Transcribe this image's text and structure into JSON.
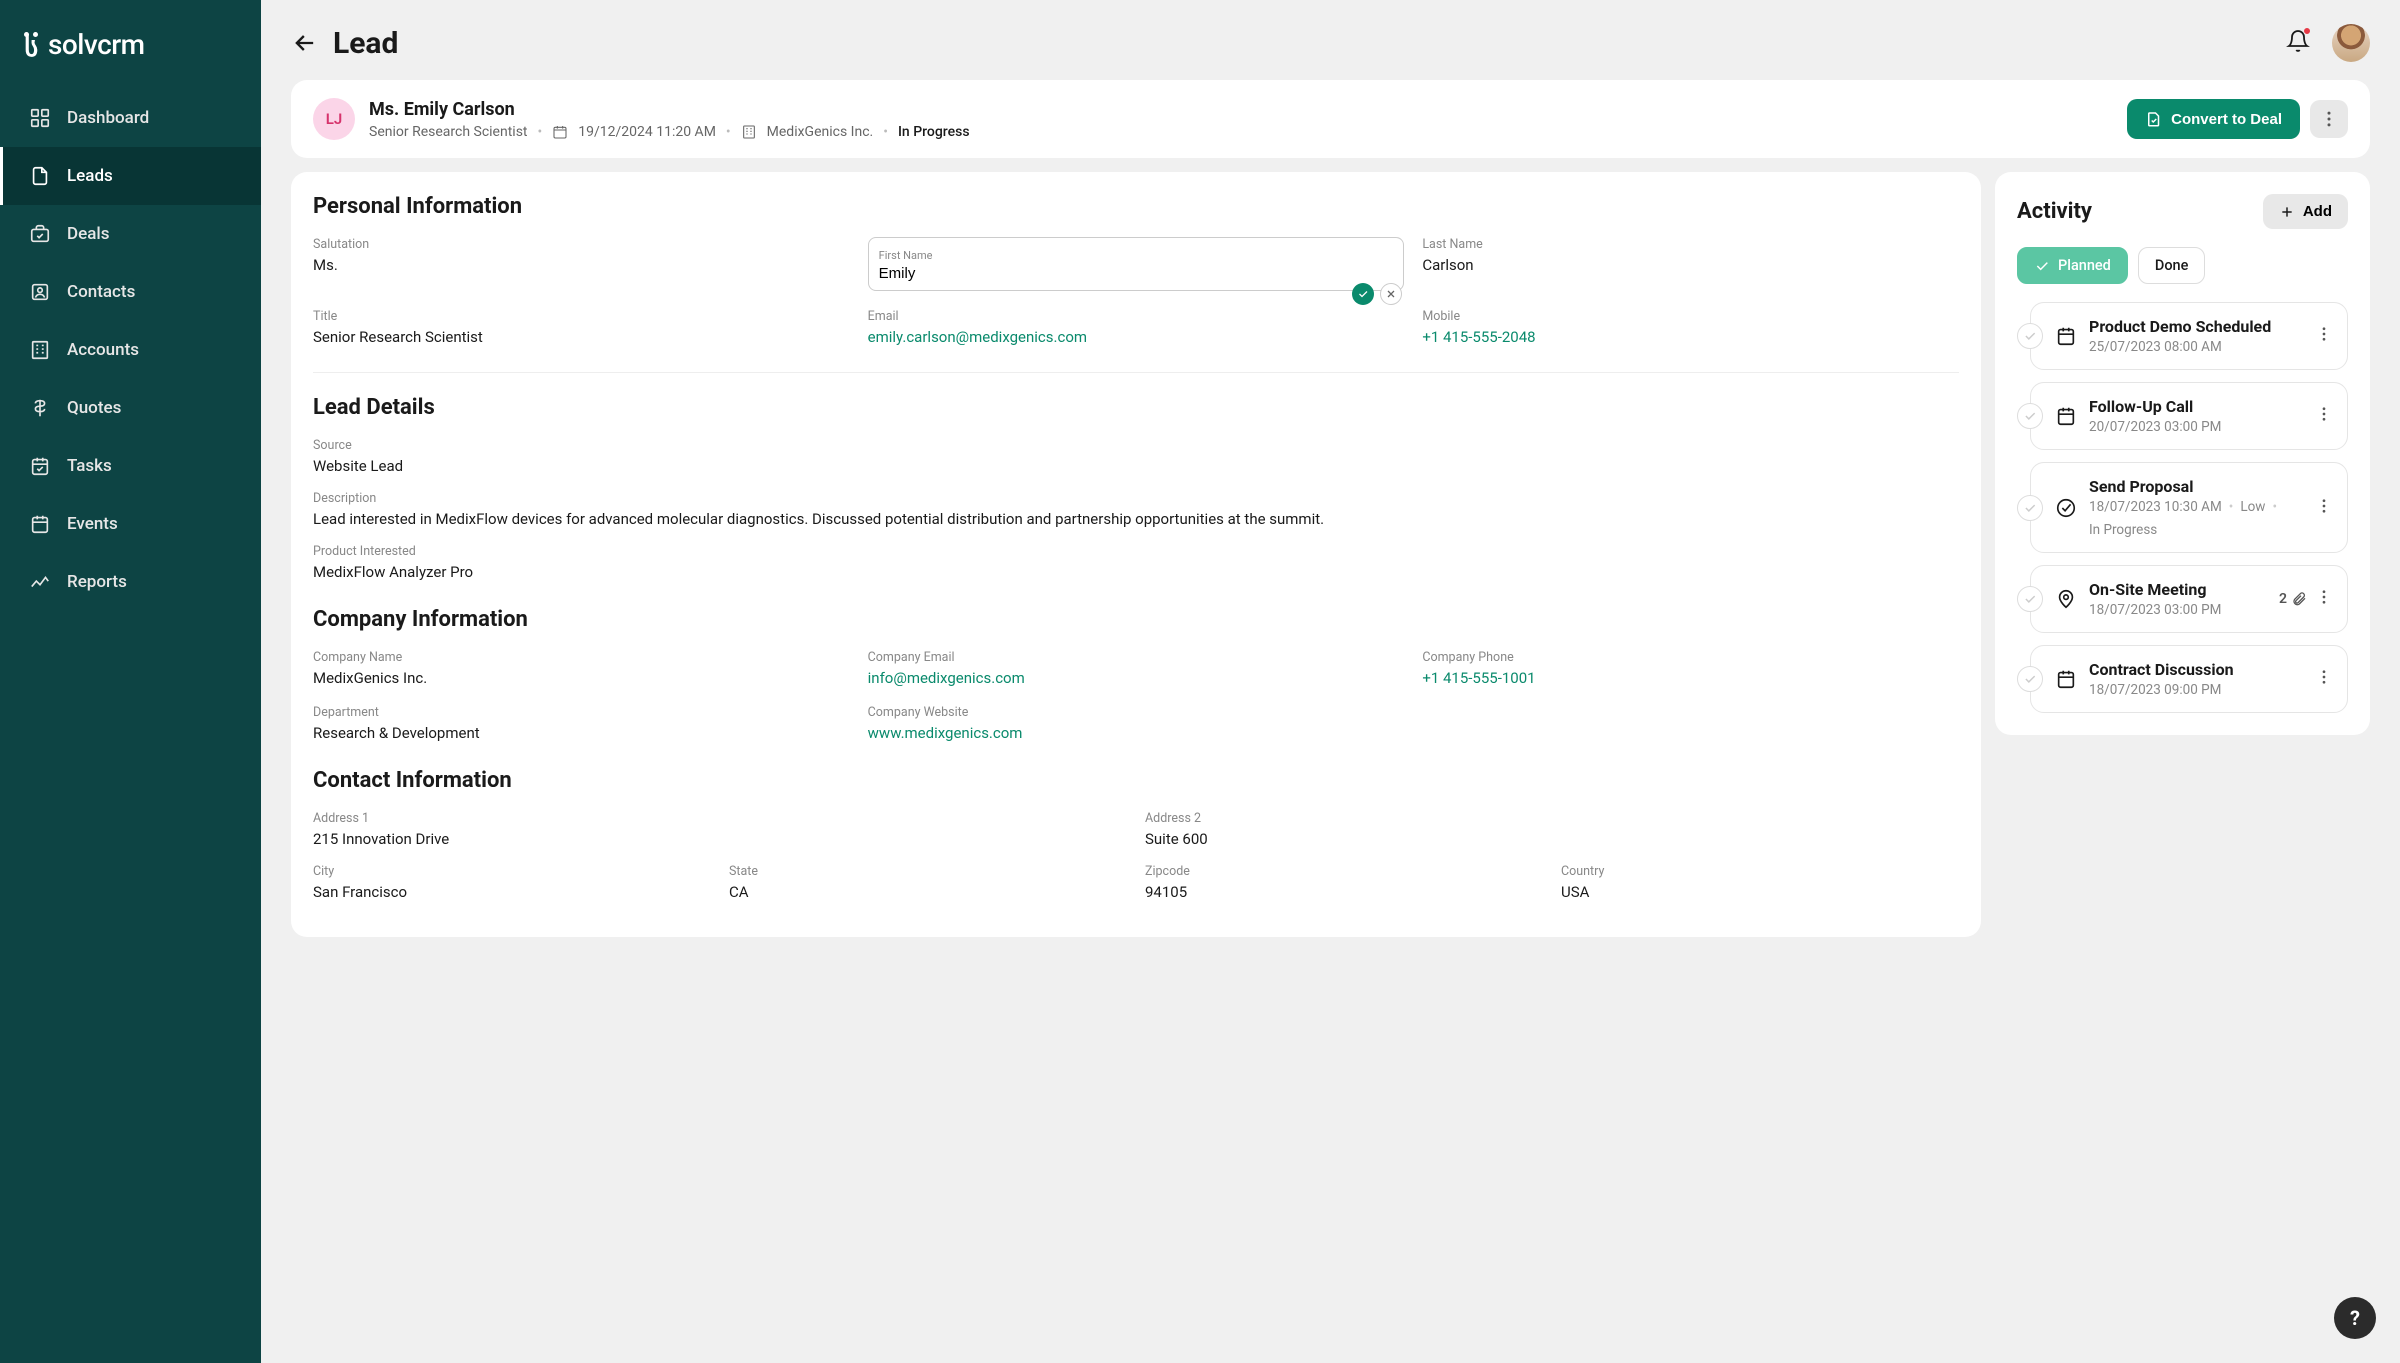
{
  "brand": "solvcrm",
  "nav": [
    {
      "label": "Dashboard",
      "icon": "dashboard"
    },
    {
      "label": "Leads",
      "icon": "leads",
      "active": true
    },
    {
      "label": "Deals",
      "icon": "deals"
    },
    {
      "label": "Contacts",
      "icon": "contacts"
    },
    {
      "label": "Accounts",
      "icon": "accounts"
    },
    {
      "label": "Quotes",
      "icon": "quotes"
    },
    {
      "label": "Tasks",
      "icon": "tasks"
    },
    {
      "label": "Events",
      "icon": "events"
    },
    {
      "label": "Reports",
      "icon": "reports"
    }
  ],
  "page_title": "Lead",
  "lead_header": {
    "avatar_initials": "LJ",
    "name": "Ms. Emily Carlson",
    "role": "Senior Research Scientist",
    "date": "19/12/2024 11:20 AM",
    "company": "MedixGenics Inc.",
    "status": "In Progress",
    "convert_label": "Convert to Deal"
  },
  "personal_info": {
    "title": "Personal Information",
    "salutation_label": "Salutation",
    "salutation": "Ms.",
    "first_name_label": "First Name",
    "first_name": "Emily",
    "last_name_label": "Last Name",
    "last_name": "Carlson",
    "role_label": "Title",
    "role": "Senior Research Scientist",
    "email_label": "Email",
    "email": "emily.carlson@medixgenics.com",
    "mobile_label": "Mobile",
    "mobile": "+1 415-555-2048"
  },
  "lead_details": {
    "title": "Lead Details",
    "source_label": "Source",
    "source": "Website Lead",
    "description_label": "Description",
    "description": "Lead interested in MedixFlow devices for advanced molecular diagnostics. Discussed potential distribution and partnership opportunities at the summit.",
    "product_label": "Product Interested",
    "product": "MedixFlow Analyzer Pro"
  },
  "company_info": {
    "title": "Company Information",
    "name_label": "Company Name",
    "name": "MedixGenics Inc.",
    "email_label": "Company Email",
    "email": "info@medixgenics.com",
    "phone_label": "Company Phone",
    "phone": "+1 415-555-1001",
    "dept_label": "Department",
    "dept": "Research & Development",
    "website_label": "Company Website",
    "website": "www.medixgenics.com"
  },
  "contact_info": {
    "title": "Contact Information",
    "addr1_label": "Address 1",
    "addr1": "215 Innovation Drive",
    "addr2_label": "Address 2",
    "addr2": "Suite 600",
    "city_label": "City",
    "city": "San Francisco",
    "state_label": "State",
    "state": "CA",
    "zip_label": "Zipcode",
    "zip": "94105",
    "country_label": "Country",
    "country": "USA"
  },
  "activity": {
    "title": "Activity",
    "add_label": "Add",
    "chip_planned": "Planned",
    "chip_done": "Done",
    "items": [
      {
        "icon": "calendar",
        "name": "Product Demo Scheduled",
        "date": "25/07/2023 08:00 AM"
      },
      {
        "icon": "calendar",
        "name": "Follow-Up Call",
        "date": "20/07/2023 03:00 PM"
      },
      {
        "icon": "task",
        "name": "Send Proposal",
        "date": "18/07/2023 10:30 AM",
        "priority": "Low",
        "status": "In Progress"
      },
      {
        "icon": "pin",
        "name": "On-Site Meeting",
        "date": "18/07/2023 03:00 PM",
        "attachments": 2
      },
      {
        "icon": "calendar",
        "name": "Contract Discussion",
        "date": "18/07/2023 09:00 PM"
      }
    ]
  },
  "help_label": "?"
}
